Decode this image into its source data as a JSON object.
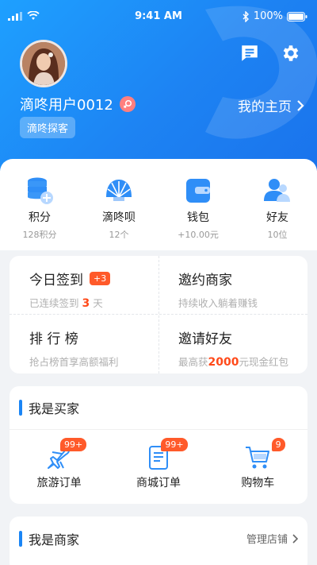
{
  "status": {
    "time": "9:41 AM",
    "battery": "100%"
  },
  "colors": {
    "brand": "#1d83f3",
    "accent": "#ff5a2a"
  },
  "profile": {
    "username": "滴咚用户0012",
    "level": "滴咚探客",
    "homepage_link": "我的主页"
  },
  "stats": [
    {
      "label": "积分",
      "value": "128积分",
      "icon": "database-coins-icon"
    },
    {
      "label": "滴咚呗",
      "value": "12个",
      "icon": "shell-icon"
    },
    {
      "label": "钱包",
      "value": "+10.00元",
      "icon": "wallet-icon"
    },
    {
      "label": "好友",
      "value": "10位",
      "icon": "friends-icon"
    }
  ],
  "actions": {
    "checkin": {
      "title": "今日签到",
      "badge": "+3",
      "sub_prefix": "已连续签到",
      "days": "3",
      "sub_suffix": "天"
    },
    "invite_merchant": {
      "title": "邀约商家",
      "sub": "持续收入躺着赚钱"
    },
    "ranking": {
      "title": "排 行 榜",
      "sub": "抢占榜首享高额福利"
    },
    "invite_friend": {
      "title": "邀请好友",
      "sub_prefix": "最高获",
      "amount": "2000",
      "sub_suffix": "元现金红包"
    }
  },
  "buyer": {
    "title": "我是买家",
    "orders": [
      {
        "label": "旅游订单",
        "count": "99+",
        "icon": "airplane-icon"
      },
      {
        "label": "商城订单",
        "count": "99+",
        "icon": "document-icon"
      },
      {
        "label": "购物车",
        "count": "9",
        "icon": "cart-icon"
      }
    ]
  },
  "merchant": {
    "title": "我是商家",
    "manage_link": "管理店铺"
  }
}
